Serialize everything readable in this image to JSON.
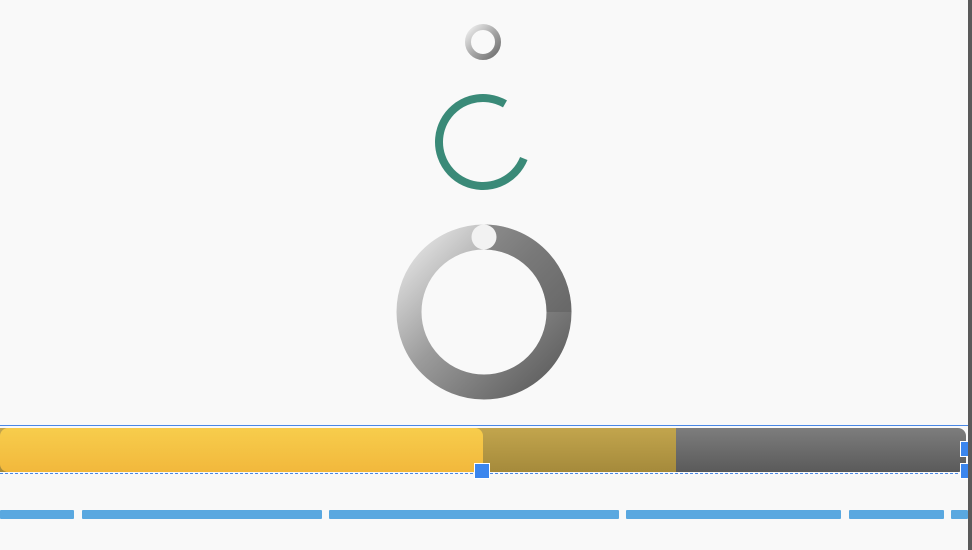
{
  "spinners": [
    {
      "name": "small-gray-ring",
      "type": "indeterminate"
    },
    {
      "name": "teal-arc",
      "type": "indeterminate",
      "color": "#3a8a78"
    },
    {
      "name": "large-gray-ring",
      "type": "indeterminate"
    }
  ],
  "progress": {
    "value": 0.5,
    "buffer": 0.7,
    "colors": {
      "fill": "#f5c543",
      "buffer": "#b5983f",
      "track": "#6b6b6b"
    },
    "selected": true
  },
  "segmented_progress": {
    "color": "#5aa8e0",
    "segments": 6
  },
  "icons": {
    "small_spinner": "spinner-ring-icon",
    "arc_spinner": "spinner-arc-icon",
    "large_spinner": "spinner-ring-icon"
  }
}
